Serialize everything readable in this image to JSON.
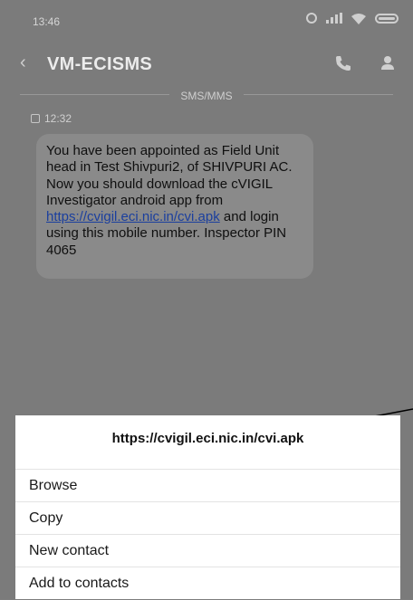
{
  "status_bar": {
    "time": "13:46",
    "icons": [
      "alarm-icon",
      "signal-icon",
      "wifi-icon",
      "battery-icon"
    ]
  },
  "header": {
    "back_icon": "‹",
    "title": "VM-ECISMS",
    "actions": [
      "call-icon",
      "contact-icon"
    ]
  },
  "thread": {
    "divider_label": "SMS/MMS",
    "message": {
      "time": "12:32",
      "text_before_link": "You have been appointed as Field Unit head in Test Shivpuri2, of SHIVPURI AC. Now you should download the cVIGIL Investigator android app from ",
      "link": "https://cvigil.eci.nic.in/cvi.apk",
      "text_after_link": " and login using this mobile number. Inspector PIN 4065"
    }
  },
  "sheet": {
    "title": "https://cvigil.eci.nic.in/cvi.apk",
    "items": [
      "Browse",
      "Copy",
      "New contact",
      "Add to contacts"
    ]
  },
  "colors": {
    "dim_background": "#7b7b7b",
    "sheet_background": "#ffffff",
    "link": "#1b3f9e"
  }
}
